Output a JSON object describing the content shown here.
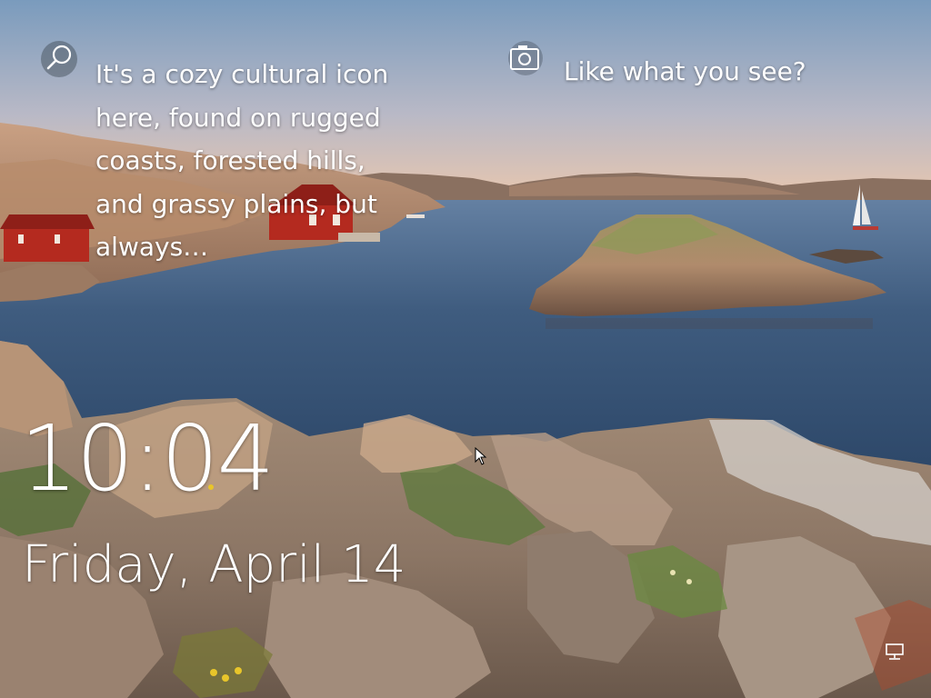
{
  "lock_screen": {
    "spotlight": {
      "icon": "search-icon",
      "text": "It's a cozy cultural icon here, found on rugged coasts, forested hills, and grassy plains, but always…"
    },
    "feedback": {
      "icon": "camera-icon",
      "text": "Like what you see?"
    },
    "clock": {
      "time": "10:04",
      "date": "Friday, April 14"
    },
    "status": {
      "network_icon": "network-wired-icon"
    }
  },
  "colors": {
    "text": "#ffffff",
    "sky_top": "#7d9dbd",
    "sky_bottom": "#e8c3a8",
    "water": "#3c5877",
    "rock": "#b79477",
    "house_red": "#b52b20"
  }
}
